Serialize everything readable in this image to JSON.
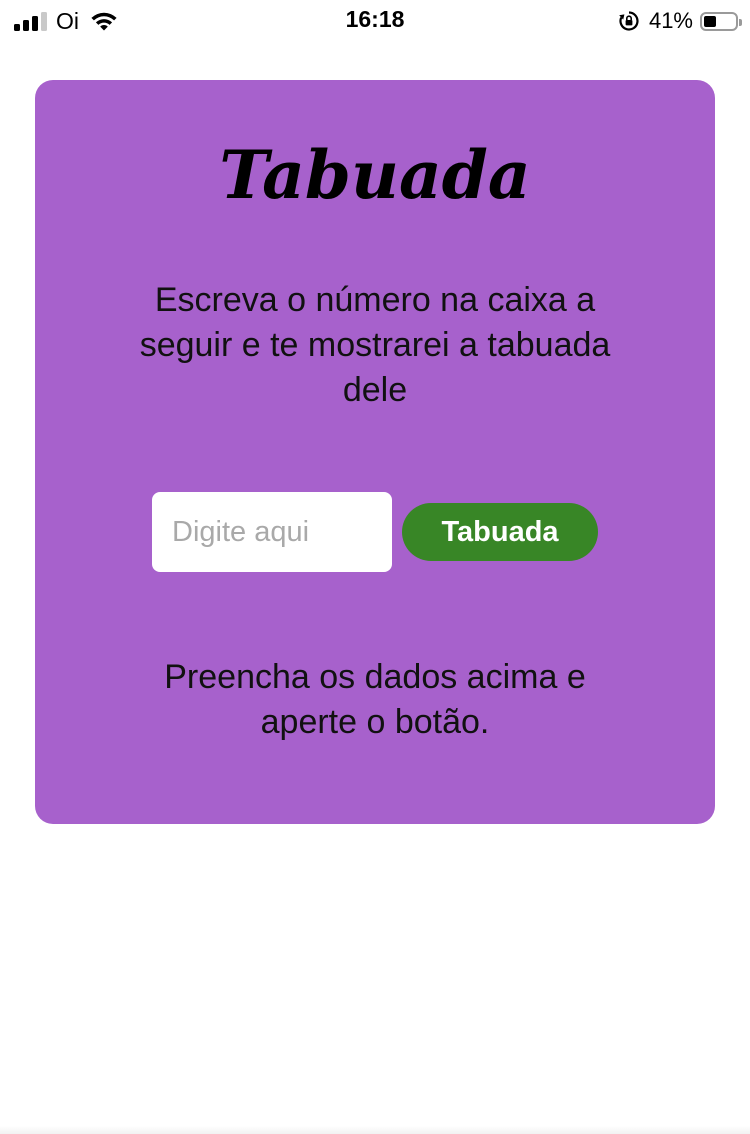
{
  "status_bar": {
    "carrier": "Oi",
    "time": "16:18",
    "battery_percent": "41%",
    "battery_level": 0.41,
    "signal_bars_active": 3,
    "signal_bars_total": 4,
    "icons": [
      "signal-icon",
      "wifi-icon",
      "rotation-lock-icon",
      "battery-icon"
    ]
  },
  "card": {
    "background_color": "#a761cc",
    "title": "Tabuada",
    "instructions": "Escreva o número na caixa a seguir e te mostrarei a tabuada dele",
    "input": {
      "value": "",
      "placeholder": "Digite aqui"
    },
    "button": {
      "label": "Tabuada",
      "color": "#388626"
    },
    "result": "Preencha os dados acima e aperte o botão."
  }
}
